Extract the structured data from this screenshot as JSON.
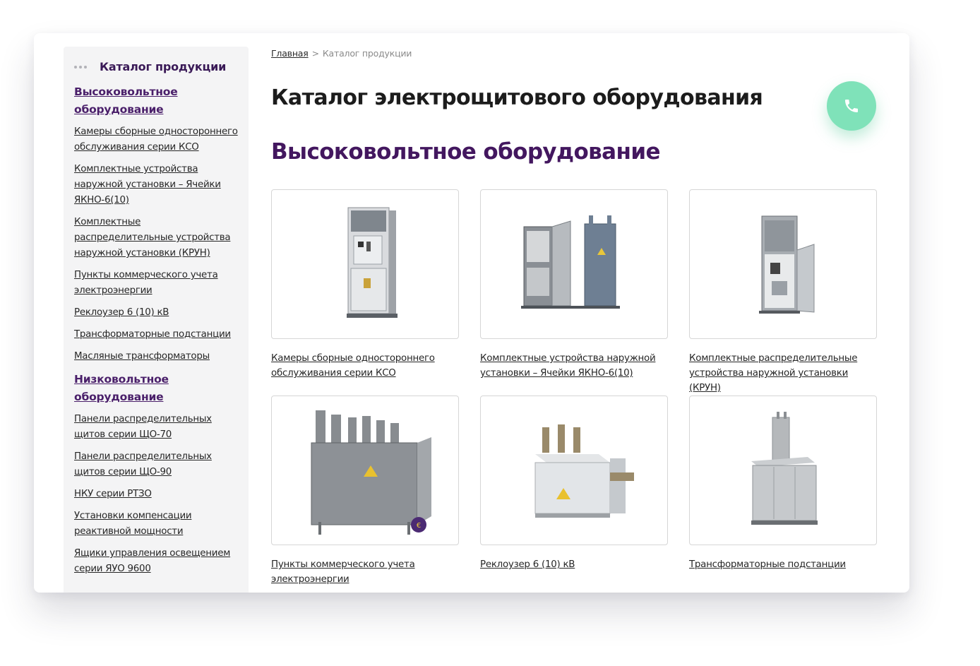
{
  "breadcrumb": {
    "home": "Главная",
    "separator": ">",
    "current": "Каталог продукции"
  },
  "sidebar": {
    "title": "Каталог продукции",
    "groups": [
      {
        "label": "Высоковольтное оборудование",
        "items": [
          "Камеры сборные одностороннего обслуживания серии КСО",
          "Комплектные устройства наружной установки – Ячейки ЯКНО-6(10)",
          "Комплектные распределительные устройства наружной установки (КРУН)",
          "Пункты коммерческого учета электроэнергии",
          "Реклоузер 6 (10) кВ",
          "Трансформаторные подстанции",
          "Масляные трансформаторы"
        ]
      },
      {
        "label": "Низковольтное оборудование",
        "items": [
          "Панели распределительных щитов серии ЩО-70",
          "Панели распределительных щитов серии ЩО-90",
          "НКУ серии РТЗО",
          "Установки компенсации реактивной мощности",
          "Ящики управления освещением серии ЯУО 9600"
        ]
      }
    ]
  },
  "main": {
    "title": "Каталог электрощитового оборудования",
    "section_title": "Высоковольтное оборудование",
    "products": [
      {
        "caption": "Камеры сборные одностороннего обслуживания серии КСО",
        "icon": "kso-cabinet-image"
      },
      {
        "caption": "Комплектные устройства наружной установки – Ячейки ЯКНО-6(10)",
        "icon": "yakno-cabinet-image"
      },
      {
        "caption": "Комплектные распределительные устройства наружной установки (КРУН)",
        "icon": "krun-cabinet-image"
      },
      {
        "caption": "Пункты коммерческого учета электроэнергии",
        "icon": "metering-point-image"
      },
      {
        "caption": "Реклоузер 6 (10) кВ",
        "icon": "recloser-image"
      },
      {
        "caption": "Трансформаторные подстанции",
        "icon": "transformer-substation-image"
      }
    ]
  },
  "call_button": {
    "icon": "phone-icon",
    "color": "#7fe2b9"
  },
  "colors": {
    "accent": "#43175f",
    "sidebar_bg": "#f4f4f5"
  }
}
